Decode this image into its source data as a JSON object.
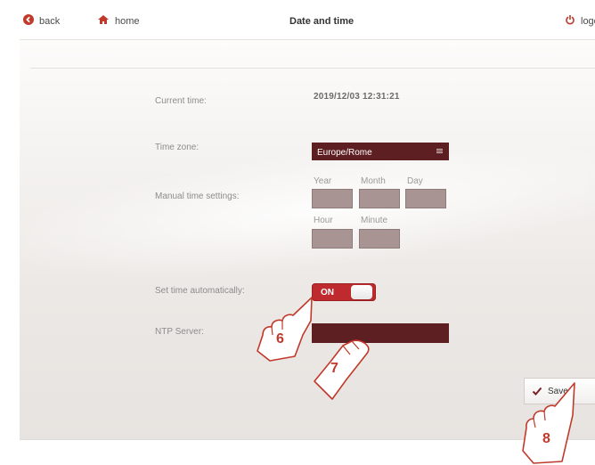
{
  "header": {
    "back_label": "back",
    "home_label": "home",
    "title": "Date and time",
    "logout_label": "logo"
  },
  "form": {
    "current_time_label": "Current time:",
    "current_time_value": "2019/12/03 12:31:21",
    "timezone_label": "Time zone:",
    "timezone_value": "Europe/Rome",
    "manual_label": "Manual time settings:",
    "manual_fields": {
      "year": "Year",
      "month": "Month",
      "day": "Day",
      "hour": "Hour",
      "minute": "Minute"
    },
    "auto_label": "Set time automatically:",
    "auto_toggle": "ON",
    "ntp_label": "NTP Server:"
  },
  "footer": {
    "save_label": "Save"
  },
  "annotations": {
    "step_6": "6",
    "step_7": "7",
    "step_8": "8"
  },
  "colors": {
    "accent_dark": "#5e1f22",
    "toggle_red": "#bf2a2f",
    "icon_red": "#c0392b"
  }
}
